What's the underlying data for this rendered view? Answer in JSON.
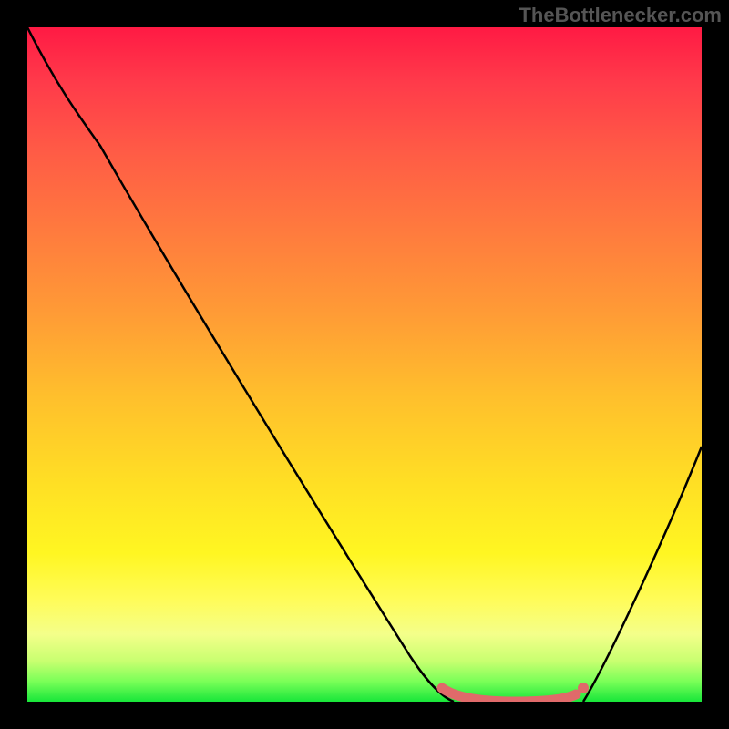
{
  "watermark": "TheBottlenecker.com",
  "colors": {
    "gradient_top": "#ff1a44",
    "gradient_mid": "#ffe024",
    "gradient_bottom": "#18e63a",
    "curve": "#000000",
    "highlight": "#e06a6a",
    "frame": "#000000"
  },
  "chart_data": {
    "type": "line",
    "title": "",
    "xlabel": "",
    "ylabel": "",
    "xlim": [
      0,
      100
    ],
    "ylim": [
      0,
      100
    ],
    "series": [
      {
        "name": "bottleneck-curve",
        "x": [
          0,
          5,
          11,
          20,
          30,
          40,
          50,
          57,
          63,
          68,
          72,
          76,
          80,
          82,
          85,
          90,
          95,
          100
        ],
        "y": [
          100,
          93,
          86,
          72,
          56,
          40,
          24,
          12,
          4,
          1,
          0,
          0,
          0,
          1,
          5,
          15,
          28,
          38
        ]
      }
    ],
    "highlight_range": {
      "name": "optimal-zone",
      "x_start": 62,
      "x_end": 82,
      "y": 0
    },
    "background": "vertical-gradient red→yellow→green representing bottleneck severity (top=worst, bottom=best)"
  }
}
